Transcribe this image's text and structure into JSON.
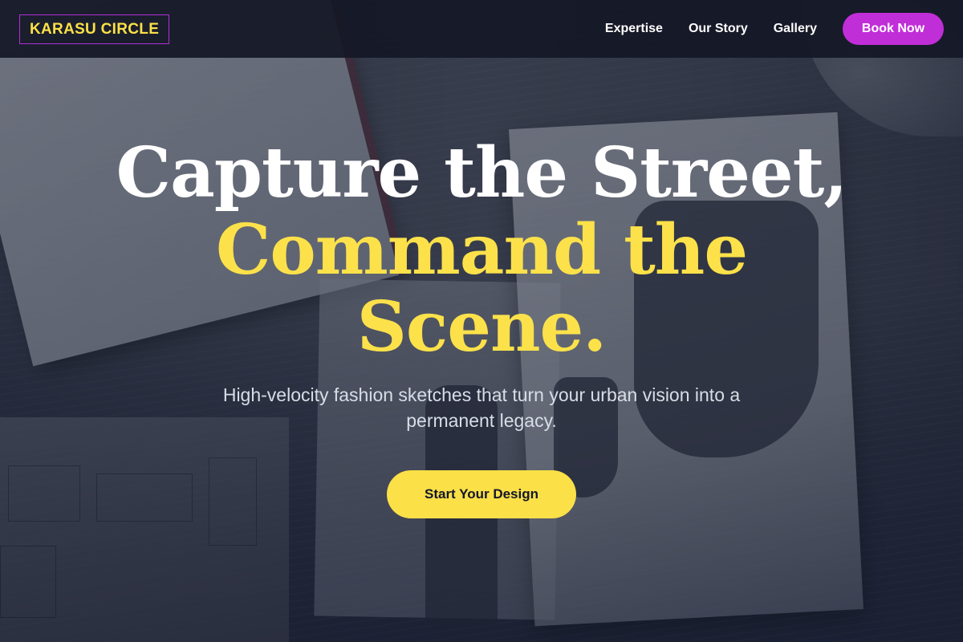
{
  "brand": {
    "name": "KARASU CIRCLE"
  },
  "nav": {
    "links": [
      "Expertise",
      "Our Story",
      "Gallery"
    ],
    "book_label": "Book Now"
  },
  "hero": {
    "headline_line1": "Capture the Street,",
    "headline_accent_line1": "Command the",
    "headline_accent_line2": "Scene.",
    "subtitle": "High-velocity fashion sketches that turn your urban vision into a permanent legacy.",
    "cta_label": "Start Your Design"
  },
  "colors": {
    "accent_yellow": "#fbe047",
    "accent_magenta": "#c02ed8",
    "nav_background": "#141826"
  }
}
